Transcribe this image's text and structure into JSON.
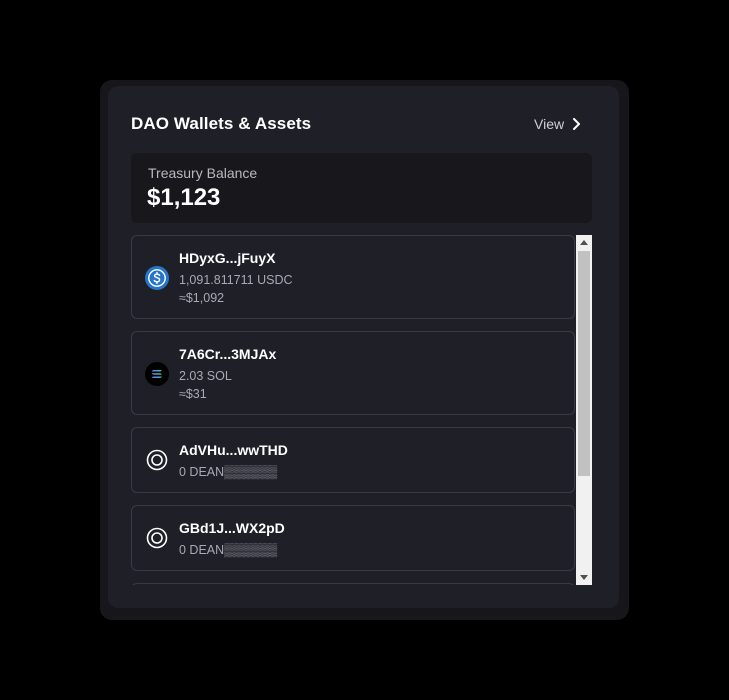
{
  "header": {
    "title": "DAO Wallets & Assets",
    "view_label": "View"
  },
  "balance": {
    "label": "Treasury Balance",
    "value": "$1,123"
  },
  "wallets": [
    {
      "name": "HDyxG...jFuyX",
      "amount": "1,091.811711 USDC",
      "usd": "≈$1,092",
      "icon": "usdc-icon"
    },
    {
      "name": "7A6Cr...3MJAx",
      "amount": "2.03 SOL",
      "usd": "≈$31",
      "icon": "solana-icon"
    },
    {
      "name": "AdVHu...wwTHD",
      "amount": "0 DEAN▒▒▒▒▒▒",
      "icon": "token-ring-icon"
    },
    {
      "name": "GBd1J...WX2pD",
      "amount": "0 DEAN▒▒▒▒▒▒",
      "icon": "token-ring-icon"
    }
  ],
  "colors": {
    "background": "#000000",
    "panel": "#1f1f28",
    "balance_box": "#17171c",
    "usdc_blue": "#2775ca"
  },
  "scrollbar": {
    "position_fraction": 0.0
  }
}
